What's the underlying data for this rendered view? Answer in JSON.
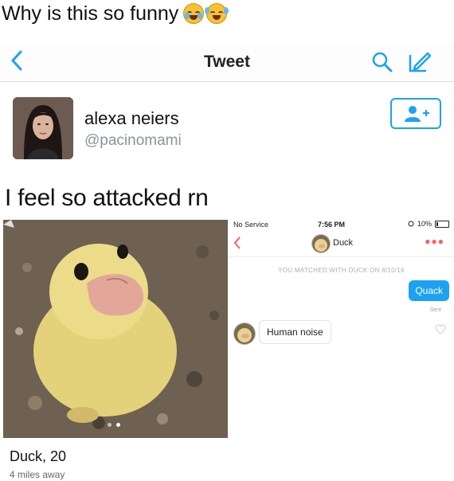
{
  "caption": "Why is this so funny",
  "navbar": {
    "title": "Tweet",
    "back_icon": "chevron-left-icon",
    "search_icon": "search-icon",
    "compose_icon": "compose-icon"
  },
  "tweet": {
    "user_name": "alexa neiers",
    "user_handle": "@pacinomami",
    "follow_icon": "add-user-icon",
    "text": "I feel so attacked rn"
  },
  "tinder_profile": {
    "name_age": "Duck, 20",
    "distance": "4 miles away",
    "photo_page_dots": 2,
    "active_dot": 1
  },
  "chat": {
    "status_left": "No Service",
    "status_time": "7:56 PM",
    "status_right": "10%",
    "contact_name": "Duck",
    "match_notice": "YOU MATCHED WITH DUCK ON 8/10/16",
    "outgoing_message": "Quack",
    "sent_label": "Sent",
    "incoming_message": "Human noise",
    "colors": {
      "accent": "#1da1f2",
      "more": "#ff5a5f"
    }
  }
}
